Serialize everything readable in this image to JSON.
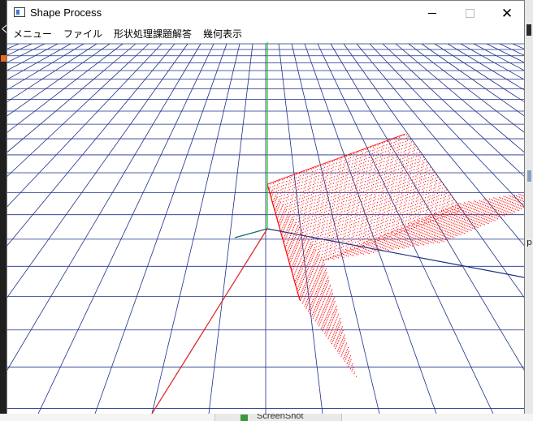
{
  "window": {
    "title": "Shape Process",
    "controls": {
      "minimize": "minimize",
      "maximize": "maximize",
      "close": "✕"
    }
  },
  "menubar": {
    "items": [
      {
        "label": "メニュー"
      },
      {
        "label": "ファイル"
      },
      {
        "label": "形状処理課題解答"
      },
      {
        "label": "幾何表示"
      }
    ]
  },
  "viewport": {
    "description_free": true,
    "colors": {
      "grid": "#1c2f8a",
      "axis_x": "#e02020",
      "axis_y": "#20c020",
      "axis_z": "#1a6a6a",
      "points": "#ff0000",
      "background": "#ffffff"
    }
  },
  "desktop": {
    "bottom_taskbar_text": "ScreenShot",
    "left_edge_glyph": "く",
    "right_edge_glyph": "p"
  }
}
